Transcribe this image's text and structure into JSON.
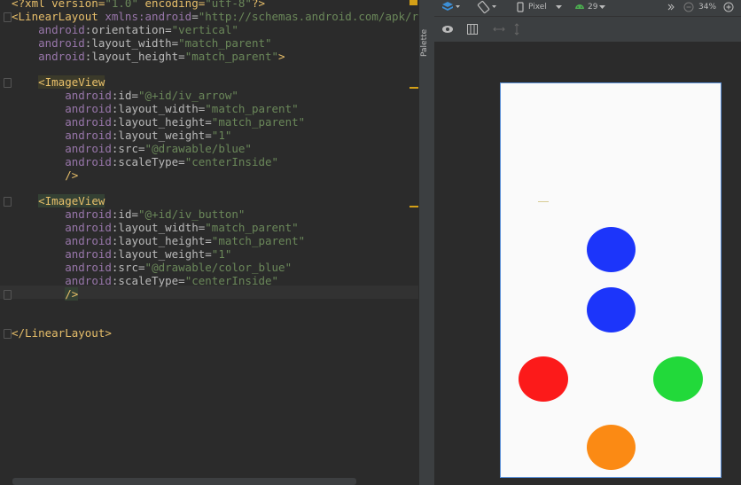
{
  "code_lines": [
    [
      [
        "t-pi",
        "<?xml version="
      ],
      [
        "t-str",
        "\"1.0\""
      ],
      [
        "t-pi",
        " encoding="
      ],
      [
        "t-str",
        "\"utf-8\""
      ],
      [
        "t-pi",
        "?>"
      ]
    ],
    [
      [
        "t-tag",
        "<LinearLayout "
      ],
      [
        "t-ns",
        "xmlns:android"
      ],
      [
        "t-attr",
        "="
      ],
      [
        "t-str",
        "\"http://schemas.android.com/apk/res/andr"
      ]
    ],
    [
      [
        "",
        "    "
      ],
      [
        "t-ns",
        "android"
      ],
      [
        "t-attr",
        ":orientation="
      ],
      [
        "t-str",
        "\"vertical\""
      ]
    ],
    [
      [
        "",
        "    "
      ],
      [
        "t-ns",
        "android"
      ],
      [
        "t-attr",
        ":layout_width="
      ],
      [
        "t-str",
        "\"match_parent\""
      ]
    ],
    [
      [
        "",
        "    "
      ],
      [
        "t-ns",
        "android"
      ],
      [
        "t-attr",
        ":layout_height="
      ],
      [
        "t-str",
        "\"match_parent\""
      ],
      [
        "t-tag",
        ">"
      ]
    ],
    [
      [
        "",
        ""
      ]
    ],
    [
      [
        "",
        "    "
      ],
      [
        "t-tag hl-tag",
        "<ImageView"
      ]
    ],
    [
      [
        "",
        "        "
      ],
      [
        "t-ns",
        "android"
      ],
      [
        "t-attr",
        ":id="
      ],
      [
        "t-str",
        "\"@+id/iv_arrow\""
      ]
    ],
    [
      [
        "",
        "        "
      ],
      [
        "t-ns",
        "android"
      ],
      [
        "t-attr",
        ":layout_width="
      ],
      [
        "t-str",
        "\"match_parent\""
      ]
    ],
    [
      [
        "",
        "        "
      ],
      [
        "t-ns",
        "android"
      ],
      [
        "t-attr",
        ":layout_height="
      ],
      [
        "t-str",
        "\"match_parent\""
      ]
    ],
    [
      [
        "",
        "        "
      ],
      [
        "t-ns",
        "android"
      ],
      [
        "t-attr",
        ":layout_weight="
      ],
      [
        "t-str",
        "\"1\""
      ]
    ],
    [
      [
        "",
        "        "
      ],
      [
        "t-ns",
        "android"
      ],
      [
        "t-attr",
        ":src="
      ],
      [
        "t-str",
        "\"@drawable/blue\""
      ]
    ],
    [
      [
        "",
        "        "
      ],
      [
        "t-ns",
        "android"
      ],
      [
        "t-attr",
        ":scaleType="
      ],
      [
        "t-str",
        "\"centerInside\""
      ]
    ],
    [
      [
        "",
        "        "
      ],
      [
        "t-tag",
        "/>"
      ]
    ],
    [
      [
        "",
        ""
      ]
    ],
    [
      [
        "",
        "    "
      ],
      [
        "t-tag caret-bg",
        "<ImageView"
      ]
    ],
    [
      [
        "",
        "        "
      ],
      [
        "t-ns",
        "android"
      ],
      [
        "t-attr",
        ":id="
      ],
      [
        "t-str",
        "\"@+id/iv_button\""
      ]
    ],
    [
      [
        "",
        "        "
      ],
      [
        "t-ns",
        "android"
      ],
      [
        "t-attr",
        ":layout_width="
      ],
      [
        "t-str",
        "\"match_parent\""
      ]
    ],
    [
      [
        "",
        "        "
      ],
      [
        "t-ns",
        "android"
      ],
      [
        "t-attr",
        ":layout_height="
      ],
      [
        "t-str",
        "\"match_parent\""
      ]
    ],
    [
      [
        "",
        "        "
      ],
      [
        "t-ns",
        "android"
      ],
      [
        "t-attr",
        ":layout_weight="
      ],
      [
        "t-str",
        "\"1\""
      ]
    ],
    [
      [
        "",
        "        "
      ],
      [
        "t-ns",
        "android"
      ],
      [
        "t-attr",
        ":src="
      ],
      [
        "t-str",
        "\"@drawable/color_blue\""
      ]
    ],
    [
      [
        "",
        "        "
      ],
      [
        "t-ns",
        "android"
      ],
      [
        "t-attr",
        ":scaleType="
      ],
      [
        "t-str",
        "\"centerInside\""
      ]
    ],
    [
      [
        "",
        "        "
      ],
      [
        "t-tag caret-bg",
        "/>"
      ]
    ],
    [
      [
        "",
        ""
      ]
    ],
    [
      [
        "",
        ""
      ]
    ],
    [
      [
        "t-tag",
        "</LinearLayout>"
      ]
    ]
  ],
  "palette_label": "Palette",
  "toolbar": {
    "device_label": "Pixel",
    "api_label": "29",
    "zoom_label": "34%"
  },
  "icons": [
    "layers-icon",
    "rotate-icon",
    "phone-icon",
    "android-icon",
    "overflow-icon",
    "zoom-out-icon",
    "zoom-in-icon",
    "eye-icon",
    "layout-icon",
    "horizontal-arrow-icon",
    "vertical-arrow-icon"
  ],
  "preview_circles": [
    {
      "name": "blue-circle-top",
      "color": "#1c35fa"
    },
    {
      "name": "blue-circle-middle",
      "color": "#1c35fa"
    },
    {
      "name": "red-circle",
      "color": "#fc1a1a"
    },
    {
      "name": "green-circle",
      "color": "#22d93a"
    },
    {
      "name": "orange-circle",
      "color": "#fb8a14"
    }
  ]
}
